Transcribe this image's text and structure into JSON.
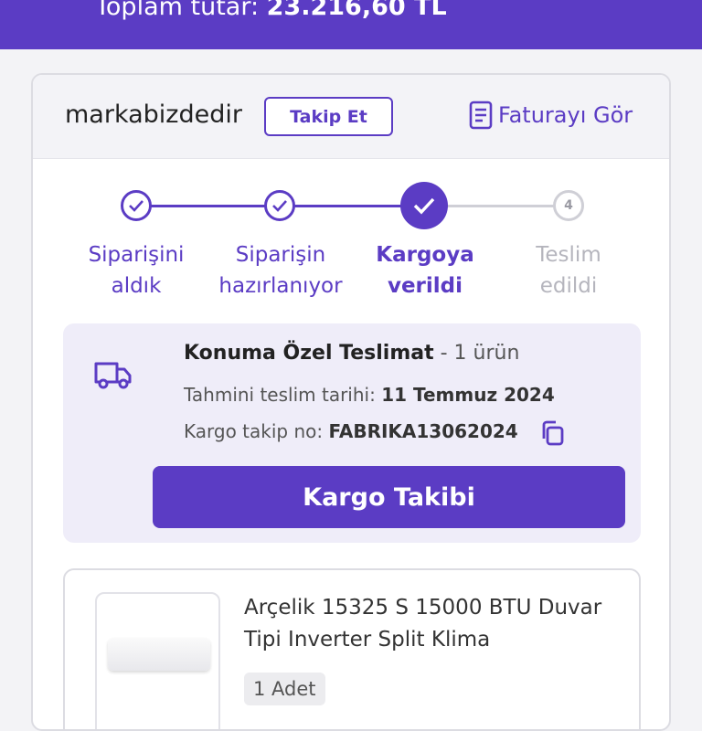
{
  "header": {
    "total_label": "Toplam tutar:",
    "total_value": "23.216,60 TL",
    "accent": "#5b3cc4"
  },
  "seller": {
    "name": "markabizdedir",
    "follow_label": "Takip Et",
    "invoice_label": "Faturayı Gör",
    "invoice_icon": "document-icon"
  },
  "steps": [
    {
      "line1": "Siparişini",
      "line2": "aldık",
      "state": "done"
    },
    {
      "line1": "Siparişin",
      "line2": "hazırlanıyor",
      "state": "done"
    },
    {
      "line1": "Kargoya",
      "line2": "verildi",
      "state": "active"
    },
    {
      "line1": "Teslim",
      "line2": "edildi",
      "state": "todo",
      "number": "4"
    }
  ],
  "delivery": {
    "icon": "truck-icon",
    "title": "Konuma Özel Teslimat",
    "count": "- 1 ürün",
    "eta_label": "Tahmini teslim tarihi:",
    "eta_value": "11 Temmuz 2024",
    "tracking_label": "Kargo takip no:",
    "tracking_value": "FABRIKA13062024",
    "copy_icon": "copy-icon",
    "button_label": "Kargo Takibi"
  },
  "product": {
    "name": "Arçelik 15325 S 15000 BTU Duvar Tipi Inverter Split Klima",
    "quantity": "1 Adet"
  }
}
